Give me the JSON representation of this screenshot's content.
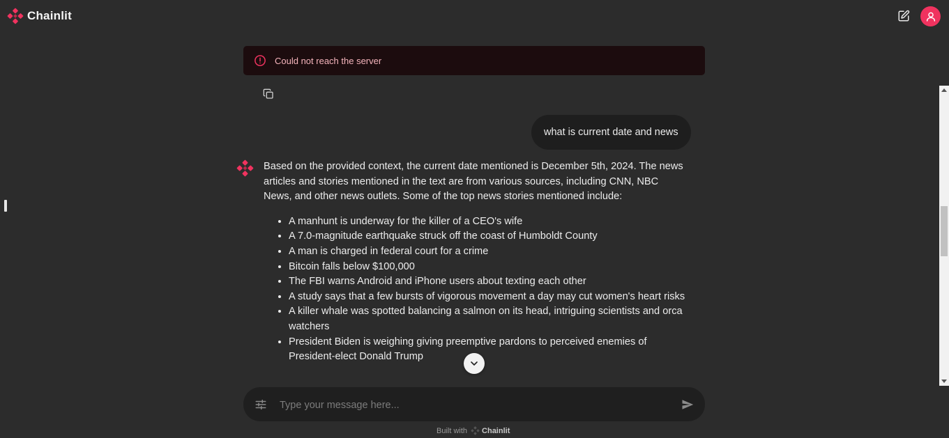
{
  "header": {
    "brand": "Chainlit",
    "new_chat_icon": "edit-icon",
    "avatar_icon": "user-icon"
  },
  "error": {
    "message": "Could not reach the server",
    "icon": "alert-circle-icon"
  },
  "user_message": {
    "text": "what is current date and news"
  },
  "assistant_message": {
    "intro": "Based on the provided context, the current date mentioned is December 5th, 2024. The news articles and stories mentioned in the text are from various sources, including CNN, NBC News, and other news outlets. Some of the top news stories mentioned include:",
    "items": [
      "A manhunt is underway for the killer of a CEO's wife",
      "A 7.0-magnitude earthquake struck off the coast of Humboldt County",
      "A man is charged in federal court for a crime",
      "Bitcoin falls below $100,000",
      "The FBI warns Android and iPhone users about texting each other",
      "A study says that a few bursts of vigorous movement a day may cut women's heart risks",
      "A killer whale was spotted balancing a salmon on its head, intriguing scientists and orca watchers",
      "President Biden is weighing giving preemptive pardons to perceived enemies of President-elect Donald Trump"
    ]
  },
  "composer": {
    "placeholder": "Type your message here...",
    "settings_icon": "sliders-icon",
    "send_icon": "send-icon"
  },
  "footer": {
    "built_with": "Built with",
    "brand": "Chainlit"
  },
  "colors": {
    "background": "#2c2c2c",
    "accent": "#f0335f",
    "error_bg": "#1c0c0e",
    "error_text": "#f5b4bc",
    "bubble": "#1e1e1e"
  }
}
